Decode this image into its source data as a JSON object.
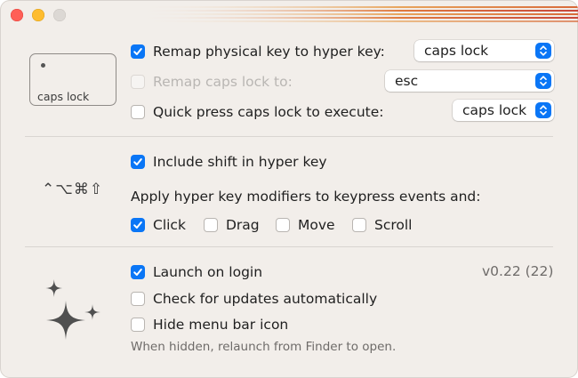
{
  "window": {
    "controls": [
      "close",
      "minimize",
      "zoom"
    ]
  },
  "key_preview": {
    "label": "caps lock"
  },
  "remap_physical": {
    "checked": true,
    "label": "Remap physical key to hyper key:",
    "selected": "caps lock"
  },
  "remap_caps": {
    "checked": false,
    "disabled": true,
    "label": "Remap caps lock to:",
    "selected": "esc"
  },
  "quick_press": {
    "checked": false,
    "label": "Quick press caps lock to execute:",
    "selected": "caps lock"
  },
  "modifiers_symbols": "⌃⌥⌘⇧",
  "include_shift": {
    "checked": true,
    "label": "Include shift in hyper key"
  },
  "apply_text": "Apply hyper key modifiers to keypress events and:",
  "events": [
    {
      "label": "Click",
      "checked": true
    },
    {
      "label": "Drag",
      "checked": false
    },
    {
      "label": "Move",
      "checked": false
    },
    {
      "label": "Scroll",
      "checked": false
    }
  ],
  "launch_on_login": {
    "checked": true,
    "label": "Launch on login"
  },
  "version": "v0.22 (22)",
  "check_updates": {
    "checked": false,
    "label": "Check for updates automatically"
  },
  "hide_menu_icon": {
    "checked": false,
    "label": "Hide menu bar icon"
  },
  "hidden_note": "When hidden, relaunch from Finder to open.",
  "colors": {
    "accent": "#0a76f6",
    "window_bg": "#f2eeea",
    "stripe_orange": "#e0893a",
    "stripe_red": "#c8473c"
  },
  "icons": {
    "checked": "checkmark-icon",
    "select": "updown-chevron-icon",
    "sparkle": "sparkles-icon"
  }
}
